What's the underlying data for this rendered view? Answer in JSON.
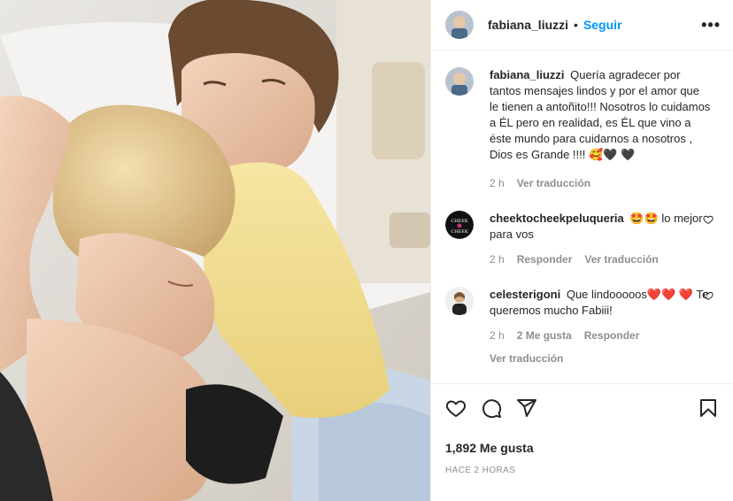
{
  "post": {
    "username": "fabiana_liuzzi",
    "separator": "•",
    "follow_label": "Seguir",
    "more_label": "•••"
  },
  "caption": {
    "username": "fabiana_liuzzi",
    "text": "Quería agradecer por tantos mensajes lindos y por el amor que le tienen a antoñito!!! Nosotros lo cuidamos a ÉL pero en realidad, es ÉL que vino a éste mundo para cuidarnos a nosotros , Dios es Grande !!!! 🥰🖤 🖤",
    "time": "2 h",
    "translate": "Ver traducción"
  },
  "comments": [
    {
      "username": "cheektocheekpeluqueria",
      "text": "🤩🤩 lo mejor para vos",
      "time": "2 h",
      "reply": "Responder",
      "translate": "Ver traducción",
      "avatar_text": "CHEEK TO CHEEK"
    },
    {
      "username": "celesterigoni",
      "text": "Que lindooooos❤️❤️ ❤️ Te queremos mucho Fabiii!",
      "time": "2 h",
      "likes": "2 Me gusta",
      "reply": "Responder",
      "translate": "Ver traducción"
    }
  ],
  "icons": [
    "heart-icon",
    "comment-icon",
    "share-icon",
    "bookmark-icon",
    "more-icon"
  ],
  "likes": "1,892 Me gusta",
  "posted_ago": "HACE 2 HORAS",
  "colors": {
    "accent": "#0095f6",
    "text": "#262626",
    "secondary": "#8e8e8e",
    "border": "#efefef"
  }
}
